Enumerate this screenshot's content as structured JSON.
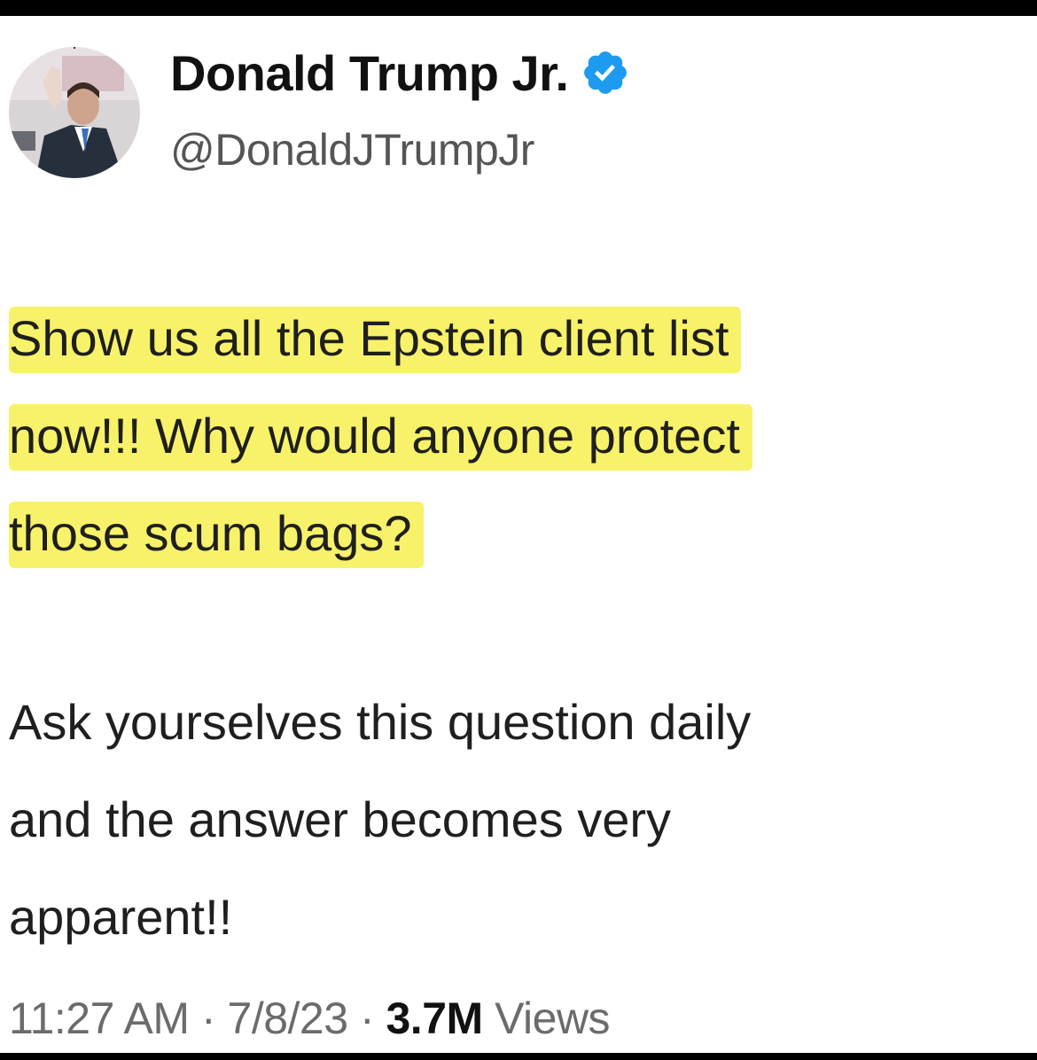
{
  "profile": {
    "display_name": "Donald Trump Jr.",
    "handle": "@DonaldJTrumpJr",
    "verified_icon": "verified-badge-icon",
    "badge_color": "#1d9bf0"
  },
  "tweet": {
    "highlighted_lines": [
      "Show us all the Epstein client list",
      "now!!! Why would anyone protect",
      "those scum bags?"
    ],
    "body_lines": [
      "Ask yourselves this question daily",
      "and the answer becomes very",
      "apparent!!"
    ],
    "highlight_color": "#f7f26a"
  },
  "meta": {
    "time": "11:27 AM",
    "separator": "·",
    "date": "7/8/23",
    "views_count": "3.7M",
    "views_label": "Views"
  }
}
